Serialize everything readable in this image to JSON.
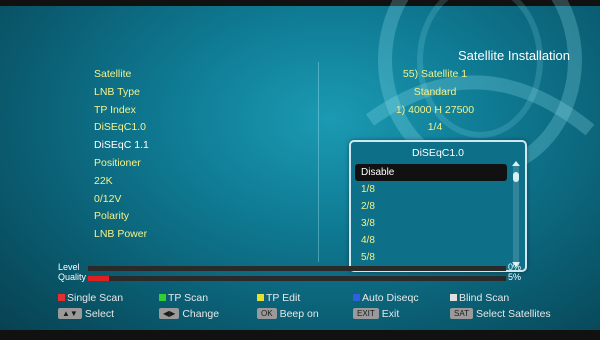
{
  "title": "Satellite Installation",
  "menu": [
    {
      "label": "Satellite",
      "value": "55) Satellite 1"
    },
    {
      "label": "LNB Type",
      "value": "Standard"
    },
    {
      "label": "TP Index",
      "value": "1) 4000 H 27500"
    },
    {
      "label": "DiSEqC1.0",
      "value": "1/4"
    },
    {
      "label": "DiSEqC 1.1",
      "value": ""
    },
    {
      "label": "Positioner",
      "value": ""
    },
    {
      "label": "22K",
      "value": ""
    },
    {
      "label": "0/12V",
      "value": ""
    },
    {
      "label": "Polarity",
      "value": ""
    },
    {
      "label": "LNB Power",
      "value": ""
    }
  ],
  "popup": {
    "title": "DiSEqC1.0",
    "items": [
      "Disable",
      "1/8",
      "2/8",
      "3/8",
      "4/8",
      "5/8"
    ],
    "selected_index": 0
  },
  "meters": {
    "level": {
      "label": "Level",
      "percent": 0,
      "percent_text": "0%",
      "color": "#888888"
    },
    "quality": {
      "label": "Quality",
      "percent": 5,
      "percent_text": "5%",
      "color": "#e02020"
    }
  },
  "legend": {
    "single_scan": {
      "label": "Single Scan",
      "color": "#e03030"
    },
    "tp_scan": {
      "label": "TP Scan",
      "color": "#30d030"
    },
    "tp_edit": {
      "label": "TP Edit",
      "color": "#e8e030"
    },
    "auto_diseqc": {
      "label": "Auto Diseqc",
      "color": "#3060e0"
    },
    "blind_scan": {
      "label": "Blind Scan",
      "color": "#e0e0e0"
    },
    "select": {
      "key": "▲▼",
      "label": "Select"
    },
    "change": {
      "key": "◀▶",
      "label": "Change"
    },
    "beep": {
      "key": "OK",
      "label": "Beep on"
    },
    "exit": {
      "key": "EXIT",
      "label": "Exit"
    },
    "sat": {
      "key": "SAT",
      "label": "Select Satellites"
    }
  }
}
